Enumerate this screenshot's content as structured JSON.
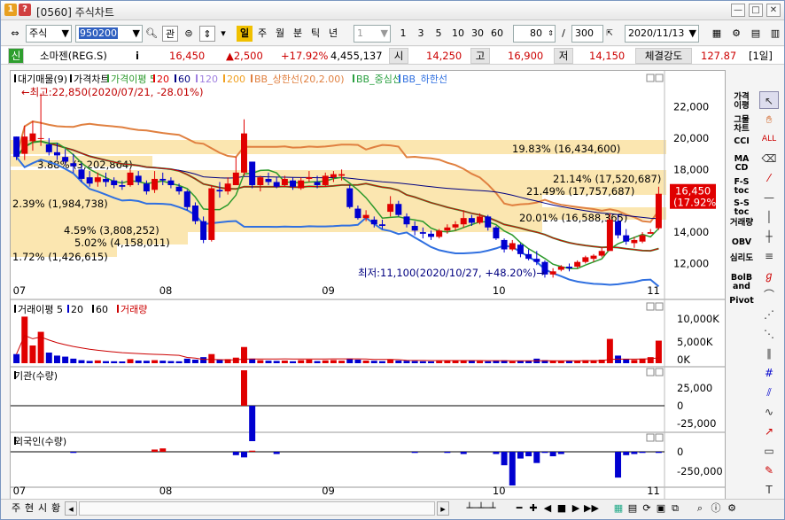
{
  "window": {
    "num": "1",
    "help": "?",
    "title": "[0560] 주식차트"
  },
  "toolbar": {
    "market": "주식",
    "code": "950200",
    "btn_gwan": "관",
    "periods": [
      "일",
      "주",
      "월",
      "분",
      "틱",
      "년"
    ],
    "interval": "1",
    "quick": [
      "1",
      "3",
      "5",
      "10",
      "30",
      "60"
    ],
    "count": "80",
    "slash": "/",
    "max": "300",
    "date": "2020/11/13"
  },
  "quote": {
    "badge": "신",
    "name": "소마젠(REG.S)",
    "info": "i",
    "price": "16,450",
    "change": "▲2,500",
    "pct": "+17.92%",
    "volume": "4,455,137",
    "open_label": "시",
    "open": "14,250",
    "high_label": "고",
    "high": "16,900",
    "low_label": "저",
    "low": "14,150",
    "strength_label": "체결강도",
    "strength": "127.87",
    "period": "[1일]"
  },
  "chart": {
    "legend_main": [
      "대기매물(9)",
      "가격차트",
      "가격이평 5",
      "20",
      "60",
      "120",
      "200",
      "BB_상한선(20,2.00)",
      "BB_중심선",
      "BB_하한선"
    ],
    "legend_colors": {
      "ma5": "#2c9a2c",
      "ma20": "#e00000",
      "ma60": "#000080",
      "ma120": "#a080e0",
      "ma200": "#f0a020",
      "bb_upper": "#e08040",
      "bb_mid": "#2aa040",
      "bb_lower": "#3070e0"
    },
    "max_note": "←최고:22,850(2020/07/21, -28.01%)",
    "min_note": "최저:11,100(2020/10/27, +48.20%)→",
    "price_axis": [
      "22,000",
      "20,000",
      "18,000",
      "16,000",
      "14,000",
      "12,000"
    ],
    "price_tag": [
      "16,450",
      "(17.92%)"
    ],
    "zones": [
      {
        "text": "19.83% (16,434,600)"
      },
      {
        "text": "21.14% (17,520,687)"
      },
      {
        "text": "21.49% (17,757,687)"
      },
      {
        "text": "3.88% (3,202,864)"
      },
      {
        "text": "2.39% (1,984,738)"
      },
      {
        "text": "20.01% (16,588,365)"
      },
      {
        "text": "4.59% (3,808,252)"
      },
      {
        "text": "5.02% (4,158,011)"
      },
      {
        "text": "1.72% (1,426,615)"
      }
    ],
    "months": [
      "07",
      "08",
      "09",
      "10",
      "11"
    ],
    "vol_legend": [
      "거래이평 5",
      "20",
      "60",
      "거래량"
    ],
    "vol_axis": [
      "10,000K",
      "5,000K",
      "0K"
    ],
    "inst_title": "기관(수량)",
    "inst_axis": [
      "25,000",
      "0",
      "-25,000"
    ],
    "foreign_title": "외국인(수량)",
    "foreign_axis": [
      "0",
      "-250,000"
    ]
  },
  "chart_data": {
    "type": "candlestick",
    "price_ylim": [
      10500,
      23500
    ],
    "candles": [
      [
        20100,
        20100,
        18600,
        18800
      ],
      [
        19000,
        20800,
        18600,
        20100
      ],
      [
        19800,
        21100,
        19200,
        20300
      ],
      [
        20000,
        22850,
        19500,
        20000
      ],
      [
        19600,
        20000,
        18900,
        19100
      ],
      [
        19100,
        19700,
        18600,
        18900
      ],
      [
        18800,
        19300,
        18300,
        18500
      ],
      [
        18400,
        19000,
        17800,
        18200
      ],
      [
        18000,
        18400,
        17200,
        17400
      ],
      [
        17500,
        17900,
        16900,
        17100
      ],
      [
        17200,
        17800,
        16900,
        17500
      ],
      [
        17400,
        17800,
        16900,
        17200
      ],
      [
        17300,
        17500,
        16800,
        17000
      ],
      [
        17000,
        17300,
        16700,
        16900
      ],
      [
        17000,
        18000,
        16900,
        17800
      ],
      [
        17600,
        17900,
        17000,
        17200
      ],
      [
        17100,
        17300,
        16400,
        16600
      ],
      [
        16700,
        17900,
        16500,
        17400
      ],
      [
        17400,
        17800,
        17000,
        17300
      ],
      [
        17300,
        17500,
        16800,
        17000
      ],
      [
        16900,
        17100,
        16400,
        16600
      ],
      [
        16600,
        16700,
        15400,
        15600
      ],
      [
        15700,
        15900,
        14500,
        14700
      ],
      [
        14700,
        15000,
        13300,
        13500
      ],
      [
        13500,
        17000,
        13400,
        16800
      ],
      [
        16700,
        17200,
        16200,
        16600
      ],
      [
        16600,
        17500,
        16400,
        17100
      ],
      [
        17000,
        18800,
        17200,
        17800
      ],
      [
        17800,
        21200,
        17600,
        20300
      ],
      [
        18500,
        18500,
        16800,
        17000
      ],
      [
        17000,
        17600,
        16600,
        17500
      ],
      [
        17400,
        17800,
        17000,
        17200
      ],
      [
        17200,
        17500,
        16800,
        16900
      ],
      [
        17000,
        17600,
        16900,
        17400
      ],
      [
        17300,
        17500,
        16700,
        16900
      ],
      [
        16800,
        17500,
        16700,
        17300
      ],
      [
        17400,
        17900,
        17200,
        17500
      ],
      [
        17200,
        17600,
        16800,
        17000
      ],
      [
        17000,
        17800,
        16900,
        17600
      ],
      [
        17500,
        17900,
        17200,
        17700
      ],
      [
        17600,
        18000,
        17300,
        17700
      ],
      [
        16800,
        17000,
        15500,
        15600
      ],
      [
        15500,
        15700,
        14800,
        14900
      ],
      [
        14900,
        15400,
        14700,
        15100
      ],
      [
        14800,
        15000,
        14300,
        14500
      ],
      [
        14500,
        14800,
        14200,
        14400
      ],
      [
        15300,
        16300,
        15000,
        15800
      ],
      [
        15800,
        16000,
        15000,
        15100
      ],
      [
        15000,
        15200,
        14300,
        14500
      ],
      [
        14400,
        14700,
        13800,
        14100
      ],
      [
        14000,
        14300,
        13600,
        13900
      ],
      [
        13900,
        14100,
        13500,
        13700
      ],
      [
        13700,
        14200,
        13600,
        14100
      ],
      [
        14100,
        14500,
        13900,
        14300
      ],
      [
        14300,
        14700,
        14100,
        14500
      ],
      [
        14500,
        15400,
        14300,
        14900
      ],
      [
        14900,
        15100,
        14400,
        14600
      ],
      [
        14600,
        15200,
        14500,
        15000
      ],
      [
        15000,
        15100,
        14100,
        14300
      ],
      [
        14300,
        14400,
        13500,
        13600
      ],
      [
        13500,
        13600,
        12700,
        12900
      ],
      [
        12900,
        13500,
        12800,
        13300
      ],
      [
        13200,
        13300,
        12400,
        12600
      ],
      [
        12600,
        12900,
        12200,
        12300
      ],
      [
        12300,
        12800,
        11900,
        12100
      ],
      [
        12100,
        12200,
        11100,
        11300
      ],
      [
        11300,
        11700,
        11100,
        11500
      ],
      [
        11600,
        11900,
        11500,
        11800
      ],
      [
        11800,
        12000,
        11500,
        11700
      ],
      [
        11800,
        12200,
        11700,
        12100
      ],
      [
        12100,
        12500,
        12000,
        12400
      ],
      [
        12300,
        12600,
        12100,
        12500
      ],
      [
        12500,
        13000,
        12400,
        12800
      ],
      [
        12800,
        15200,
        13000,
        14800
      ],
      [
        14700,
        15100,
        13600,
        13800
      ],
      [
        13800,
        14200,
        13200,
        13400
      ],
      [
        13300,
        13700,
        13000,
        13500
      ],
      [
        13400,
        14000,
        13300,
        13800
      ],
      [
        13900,
        14200,
        13900,
        14000
      ],
      [
        14250,
        16900,
        14150,
        16450
      ]
    ],
    "volume_k": [
      1800,
      9200,
      3500,
      6200,
      2100,
      1500,
      1300,
      900,
      600,
      450,
      550,
      400,
      380,
      350,
      800,
      520,
      480,
      600,
      500,
      420,
      380,
      900,
      700,
      1200,
      1800,
      700,
      800,
      1100,
      3200,
      900,
      600,
      500,
      450,
      520,
      380,
      600,
      700,
      420,
      560,
      620,
      500,
      900,
      700,
      520,
      480,
      400,
      700,
      520,
      480,
      420,
      380,
      360,
      420,
      450,
      480,
      600,
      520,
      420,
      380,
      520,
      560,
      380,
      520,
      480,
      900,
      600,
      480,
      420,
      450,
      520,
      600,
      580,
      700,
      4800,
      1500,
      800,
      650,
      900,
      1200,
      4455
    ],
    "inst": [
      0,
      0,
      0,
      0,
      0,
      0,
      0,
      0,
      0,
      0,
      0,
      0,
      0,
      0,
      0,
      0,
      0,
      0,
      0,
      0,
      0,
      0,
      0,
      0,
      0,
      0,
      0,
      0,
      30000,
      -30000,
      0,
      0,
      0,
      0,
      0,
      0,
      0,
      0,
      0,
      0,
      0,
      0,
      0,
      0,
      0,
      0,
      0,
      0,
      0,
      0,
      0,
      0,
      0,
      0,
      0,
      0,
      0,
      0,
      0,
      0,
      0,
      0,
      0,
      0,
      0,
      0,
      0,
      0,
      0,
      0,
      0,
      0,
      0,
      0,
      0,
      0,
      0,
      0,
      0,
      0
    ],
    "foreign": [
      0,
      0,
      0,
      0,
      0,
      0,
      0,
      -10000,
      0,
      0,
      0,
      0,
      0,
      0,
      0,
      0,
      0,
      20000,
      30000,
      0,
      0,
      0,
      0,
      0,
      0,
      0,
      0,
      -30000,
      -50000,
      10000,
      0,
      0,
      -20000,
      0,
      0,
      0,
      0,
      0,
      0,
      0,
      0,
      0,
      0,
      0,
      0,
      0,
      0,
      0,
      0,
      -10000,
      0,
      0,
      0,
      -10000,
      0,
      -20000,
      0,
      0,
      0,
      -20000,
      -120000,
      -300000,
      -60000,
      -40000,
      -100000,
      -10000,
      -40000,
      -20000,
      0,
      0,
      0,
      0,
      0,
      0,
      -230000,
      -30000,
      -20000,
      -10000,
      0,
      -10000,
      0
    ],
    "months_at": [
      0,
      18,
      38,
      59,
      78
    ]
  },
  "sidebar": [
    "가격이평",
    "그물차트",
    "CCI",
    "MACD",
    "F-Stoc",
    "S-Stoc",
    "거래량",
    "OBV",
    "심리도",
    "BolBand",
    "Pivot"
  ],
  "bottom": {
    "tabs": [
      "주",
      "현",
      "시",
      "황"
    ]
  }
}
